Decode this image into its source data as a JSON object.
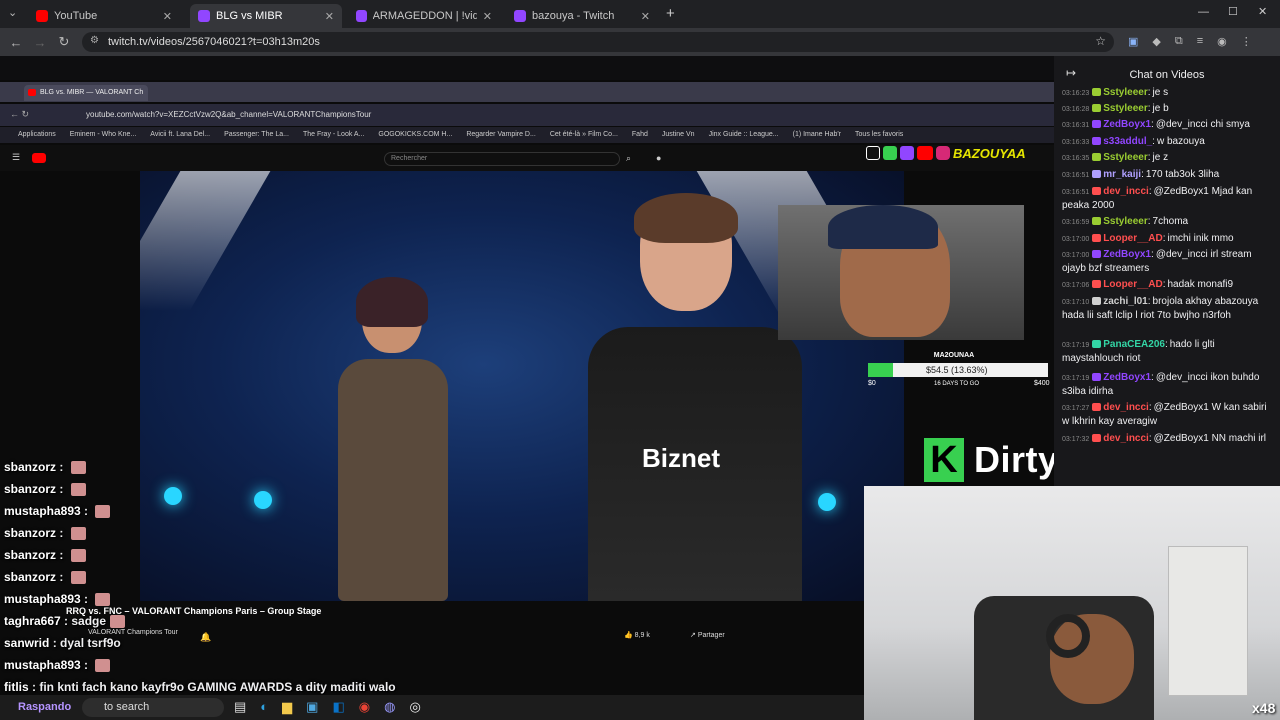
{
  "browser": {
    "tabs": [
      {
        "title": "YouTube",
        "active": false
      },
      {
        "title": "BLG vs MIBR",
        "active": true
      },
      {
        "title": "ARMAGEDDON | !video | !socia",
        "active": false
      },
      {
        "title": "bazouya - Twitch",
        "active": false
      }
    ],
    "url": "twitch.tv/videos/2567046021?t=03h13m20s",
    "window_controls": {
      "minimize": "—",
      "maximize": "☐",
      "close": "✕"
    }
  },
  "inner_browser": {
    "tab_title": "BLG vs. MIBR — VALORANT Ch",
    "url": "youtube.com/watch?v=XEZCctVzw2Q&ab_channel=VALORANTChampionsTour",
    "bookmarks": [
      "Applications",
      "Eminem - Who Kne...",
      "Avicii ft. Lana Del...",
      "Passenger: The La...",
      "The Fray - Look A...",
      "GOGOKICKS.COM H...",
      "Regarder Vampire D...",
      "Cet été-là » Film Co...",
      "Fahd",
      "Justine Vn",
      "Jinx Guide :: League...",
      "(1) Imane Hab'r",
      "Tous les favoris"
    ],
    "search_placeholder": "Rechercher",
    "video_title": "RRQ vs. FNC – VALORANT Champions Paris – Group Stage",
    "channel": "VALORANT Champions Tour",
    "likes": "8,9 k",
    "share": "Partager",
    "jersey_sponsor": "Biznet"
  },
  "stream_overlay": {
    "social_handle": "BAZOUYAA",
    "goal": {
      "title": "MA2OUNAA",
      "amount": "$54.5 (13.63%)",
      "start": "$0",
      "end": "$400",
      "days": "16 DAYS TO GO",
      "progress": 0.1363
    },
    "brand_text": "DirtyHowaAnaa",
    "brand_letter": "K",
    "viewer_badge": "x48",
    "overlay_chat": [
      {
        "user": "sbanzorz",
        "text": "",
        "color": "#ffffff",
        "emote": true
      },
      {
        "user": "sbanzorz",
        "text": "",
        "color": "#ffffff",
        "emote": true
      },
      {
        "user": "mustapha893",
        "text": "",
        "color": "#ffffff",
        "emote": true
      },
      {
        "user": "sbanzorz",
        "text": "",
        "color": "#ffffff",
        "emote": true
      },
      {
        "user": "sbanzorz",
        "text": "",
        "color": "#ffffff",
        "emote": true
      },
      {
        "user": "sbanzorz",
        "text": "",
        "color": "#ffffff",
        "emote": true
      },
      {
        "user": "mustapha893",
        "text": "",
        "color": "#ffffff",
        "emote": true
      },
      {
        "user": "taghra667",
        "text": "sadge",
        "color": "#ffffff",
        "emote": true
      },
      {
        "user": "sanwrid",
        "text": "dyal tsrf9o",
        "color": "#ffffff",
        "emote": false
      },
      {
        "user": "mustapha893",
        "text": "",
        "color": "#ffffff",
        "emote": true
      },
      {
        "user": "fitlis",
        "text": "fin knti fach kano kayfr9o GAMING AWARDS a dity maditi walo",
        "color": "#ffffff",
        "emote": false
      }
    ],
    "taskbar_search": "to search",
    "taskbar_user": "Raspando"
  },
  "chat": {
    "header": "Chat on Videos",
    "messages": [
      {
        "ts": "03:16:23",
        "user": "Sstyleeer",
        "color": "#9acd32",
        "text": "je s"
      },
      {
        "ts": "03:16:28",
        "user": "Sstyleeer",
        "color": "#9acd32",
        "text": "je b"
      },
      {
        "ts": "03:16:31",
        "user": "ZedBoyx1",
        "color": "#9146ff",
        "text": "@dev_incci chi smya"
      },
      {
        "ts": "03:16:33",
        "user": "s33addul_",
        "color": "#9146ff",
        "text": "w bazouya"
      },
      {
        "ts": "03:16:35",
        "user": "Sstyleeer",
        "color": "#9acd32",
        "text": "je z"
      },
      {
        "ts": "03:16:51",
        "user": "mr_kaiji",
        "color": "#b0a0ff",
        "text": "170 tab3ok 3liha"
      },
      {
        "ts": "03:16:51",
        "user": "dev_incci",
        "color": "#ff4f4f",
        "text": "@ZedBoyx1 Mjad kan peaka 2000"
      },
      {
        "ts": "03:16:59",
        "user": "Sstyleeer",
        "color": "#9acd32",
        "text": "7choma"
      },
      {
        "ts": "03:17:00",
        "user": "Looper__AD",
        "color": "#ff4f4f",
        "text": "imchi inik mmo"
      },
      {
        "ts": "03:17:00",
        "user": "ZedBoyx1",
        "color": "#9146ff",
        "text": "@dev_incci irl stream ojayb bzf streamers"
      },
      {
        "ts": "03:17:06",
        "user": "Looper__AD",
        "color": "#ff4f4f",
        "text": "hadak monafi9"
      },
      {
        "ts": "03:17:10",
        "user": "zachi_l01",
        "color": "#d0d0d0",
        "text": "brojola akhay abazouya hada lii saft lclip l riot 7to bwjho n3rfoh"
      },
      {
        "ts": "03:17:19",
        "user": "PanaCEA206",
        "color": "#33d6a6",
        "text": "hado li glti maystahlouch riot"
      },
      {
        "ts": "03:17:19",
        "user": "ZedBoyx1",
        "color": "#9146ff",
        "text": "@dev_incci ikon buhdo s3iba idirha"
      },
      {
        "ts": "03:17:27",
        "user": "dev_incci",
        "color": "#ff4f4f",
        "text": "@ZedBoyx1 W kan sabiri w lkhrin kay averagiw"
      },
      {
        "ts": "03:17:32",
        "user": "dev_incci",
        "color": "#ff4f4f",
        "text": "@ZedBoyx1 NN machi irl"
      }
    ]
  }
}
